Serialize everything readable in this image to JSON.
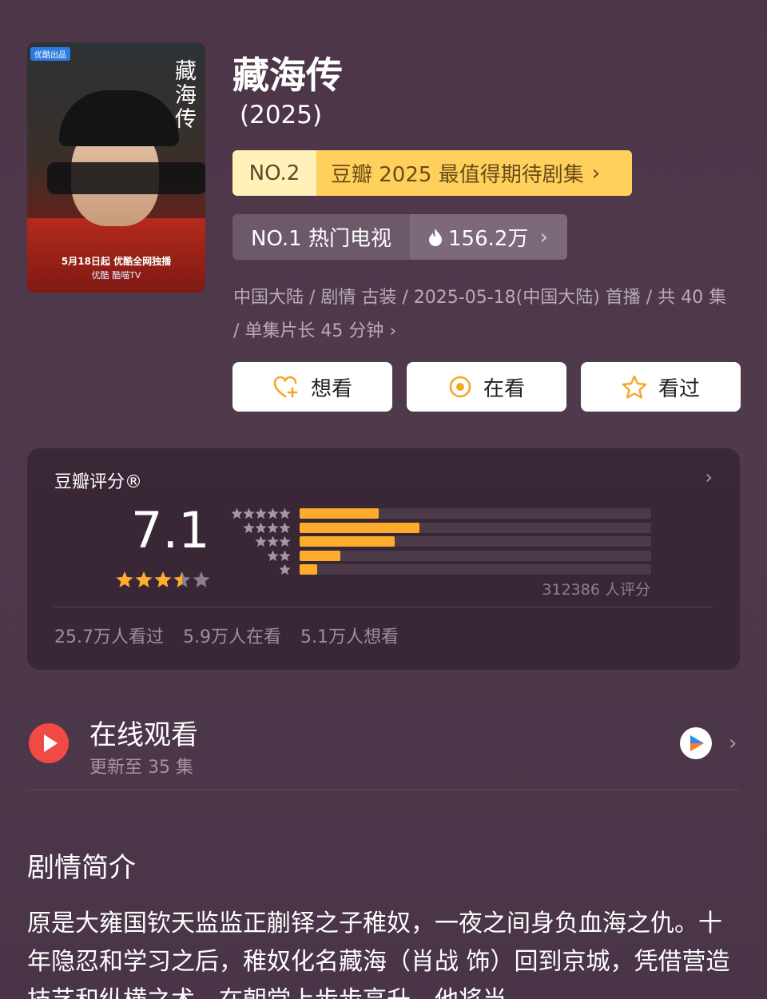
{
  "poster": {
    "badge": "优酷出品",
    "vertical_title": "藏海传",
    "tagline": "5月18日起 优酷全网独播",
    "platforms": "优酷 酷喵TV"
  },
  "title": "藏海传",
  "year": "(2025)",
  "rank1": {
    "no": "NO.2",
    "desc": "豆瓣 2025 最值得期待剧集",
    "chevron": "›"
  },
  "rank2": {
    "label": "NO.1 热门电视",
    "heat": "156.2万",
    "chevron": "›"
  },
  "meta": "中国大陆 / 剧情 古装 / 2025-05-18(中国大陆) 首播 / 共 40 集 / 单集片长 45 分钟 ›",
  "buttons": {
    "want": "想看",
    "watching": "在看",
    "watched": "看过"
  },
  "rating": {
    "label": "豆瓣评分®",
    "score": "7.1",
    "stars": 3.5,
    "distribution": [
      0.225,
      0.34,
      0.27,
      0.115,
      0.05
    ],
    "votes": "312386 人评分",
    "stats": [
      "25.7万人看过",
      "5.9万人在看",
      "5.1万人想看"
    ],
    "bar_color": "#ffac2d"
  },
  "online": {
    "title": "在线观看",
    "sub": "更新至 35 集"
  },
  "synopsis": {
    "heading": "剧情简介",
    "text": "原是大雍国钦天监监正蒯铎之子稚奴，一夜之间身负血海之仇。十年隐忍和学习之后，稚奴化名藏海（肖战 饰）回到京城，凭借营造技艺和纵横之术，在朝堂上步步高升，他将当"
  }
}
